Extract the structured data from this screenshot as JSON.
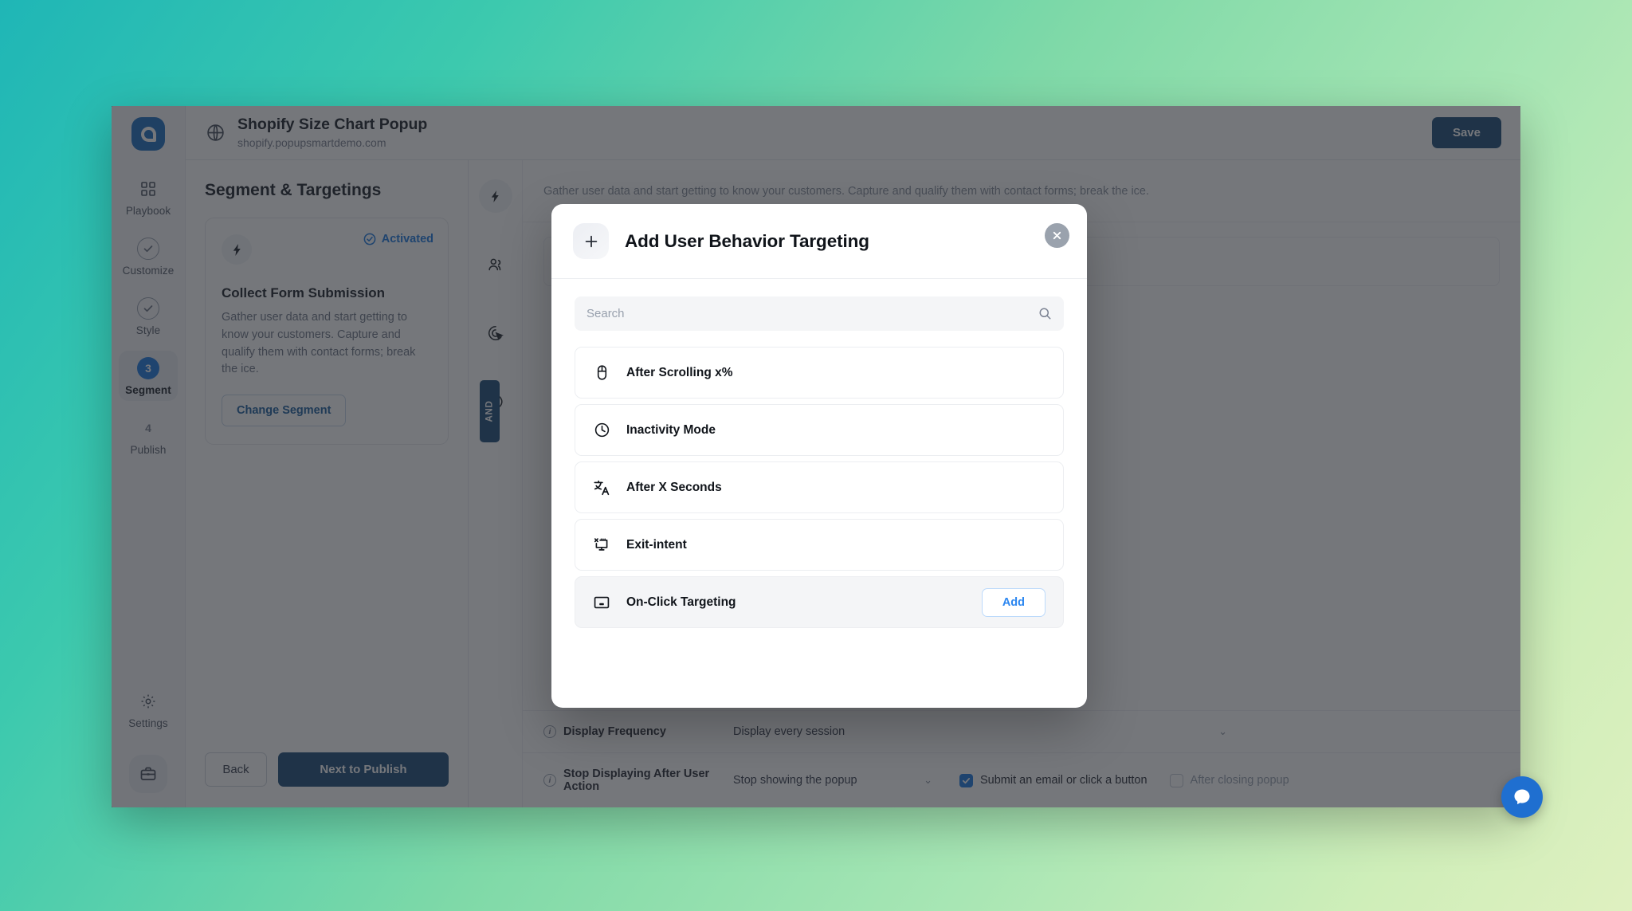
{
  "app": {
    "topbar": {
      "site_title": "Shopify Size Chart Popup",
      "site_url": "shopify.popupsmartdemo.com",
      "save_label": "Save",
      "globe_icon": "globe-icon"
    },
    "rail": {
      "logo_icon": "popupsmart-logo",
      "items": [
        {
          "label": "Playbook",
          "icon": "grid-icon",
          "state": "default"
        },
        {
          "label": "Customize",
          "icon": "check-circle-icon",
          "state": "complete"
        },
        {
          "label": "Style",
          "icon": "check-circle-icon",
          "state": "complete"
        },
        {
          "label": "Segment",
          "icon": "step-number",
          "badge": "3",
          "state": "active"
        },
        {
          "label": "Publish",
          "icon": "step-number",
          "badge": "4",
          "state": "default"
        }
      ],
      "settings_label": "Settings",
      "settings_icon": "gear-icon",
      "briefcase_icon": "briefcase-icon"
    },
    "segment_panel": {
      "heading": "Segment & Targetings",
      "card": {
        "bolt_icon": "bolt-icon",
        "status_label": "Activated",
        "status_icon": "check-circle-icon",
        "title": "Collect Form Submission",
        "description": "Gather user data and start getting to know your customers. Capture and qualify them with contact forms; break the ice.",
        "change_label": "Change Segment"
      },
      "back_label": "Back",
      "next_label": "Next to Publish"
    },
    "content": {
      "rail_icons": [
        "bolt-icon",
        "users-icon",
        "click-target-icon",
        "history-icon"
      ],
      "and_chip": "AND",
      "ghost_text": "Gather user data and start getting to know your customers. Capture and qualify them with contact forms; break the ice.",
      "settings": [
        {
          "label": "Display Frequency",
          "info_icon": "info-icon",
          "value": "Display every session",
          "chevron": "chevron-down-icon"
        },
        {
          "label": "Stop Displaying After User Action",
          "info_icon": "info-icon",
          "value": "Stop showing the popup",
          "chevron": "chevron-down-icon",
          "checkbox_options": [
            {
              "label": "Submit an email or click a button",
              "checked": true
            },
            {
              "label": "After closing popup",
              "checked": false
            }
          ]
        }
      ]
    },
    "intercom_icon": "messenger-icon"
  },
  "modal": {
    "plus_icon": "plus-icon",
    "title": "Add User Behavior Targeting",
    "close_icon": "close-icon",
    "search": {
      "placeholder": "Search",
      "value": "",
      "icon": "search-icon"
    },
    "options": [
      {
        "label": "After Scrolling x%",
        "icon": "mouse-icon",
        "hovered": false,
        "add_label": ""
      },
      {
        "label": "Inactivity Mode",
        "icon": "clock-icon",
        "hovered": false,
        "add_label": ""
      },
      {
        "label": "After X Seconds",
        "icon": "translate-icon",
        "hovered": false,
        "add_label": ""
      },
      {
        "label": "Exit-intent",
        "icon": "monitor-exit-icon",
        "hovered": false,
        "add_label": ""
      },
      {
        "label": "On-Click Targeting",
        "icon": "click-area-icon",
        "hovered": true,
        "add_label": "Add"
      }
    ]
  },
  "colors": {
    "accent_blue": "#1f7ae0",
    "deep_blue": "#1f4e79",
    "add_blue": "#2b86f0",
    "page_gradient_start": "#1fb6b6",
    "page_gradient_end": "#dff0c0"
  }
}
